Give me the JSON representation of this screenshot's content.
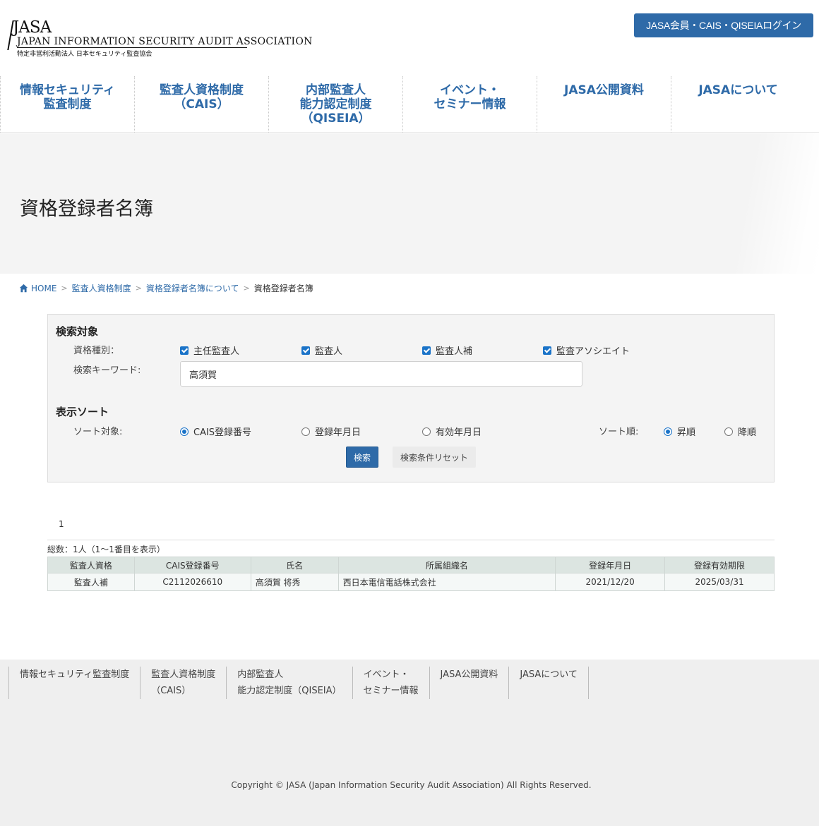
{
  "header": {
    "logo": {
      "line1": "JASA",
      "line2": "JAPAN INFORMATION SECURITY AUDIT ASSOCIATION",
      "line3": "特定非営利活動法人 日本セキュリティ監査協会"
    },
    "login_label": "JASA会員・CAIS・QISEIAログイン"
  },
  "nav": {
    "items": [
      {
        "label": "情報セキュリティ\n監査制度"
      },
      {
        "label": "監査人資格制度\n（CAIS）"
      },
      {
        "label": "内部監査人\n能力認定制度\n（QISEIA）"
      },
      {
        "label": "イベント・\nセミナー情報"
      },
      {
        "label": "JASA公開資料"
      },
      {
        "label": "JASAについて"
      }
    ]
  },
  "page": {
    "title": "資格登録者名簿"
  },
  "breadcrumb": {
    "home": "HOME",
    "items": [
      "監査人資格制度",
      "資格登録者名簿について"
    ],
    "current": "資格登録者名簿",
    "separator": ">"
  },
  "search": {
    "section_title": "検索対象",
    "type_label": "資格種別：",
    "types": [
      {
        "label": "主任監査人",
        "checked": true
      },
      {
        "label": "監査人",
        "checked": true
      },
      {
        "label": "監査人補",
        "checked": true
      },
      {
        "label": "監査アソシエイト",
        "checked": true
      }
    ],
    "keyword_label": "検索キーワード:",
    "keyword_value": "高須賀"
  },
  "sort": {
    "section_title": "表示ソート",
    "target_label": "ソート対象:",
    "targets": [
      {
        "label": "CAIS登録番号",
        "selected": true
      },
      {
        "label": "登録年月日",
        "selected": false
      },
      {
        "label": "有効年月日",
        "selected": false
      }
    ],
    "order_label": "ソート順:",
    "orders": [
      {
        "label": "昇順",
        "selected": true
      },
      {
        "label": "降順",
        "selected": false
      }
    ],
    "search_button": "検索",
    "reset_button": "検索条件リセット"
  },
  "results": {
    "page": "1",
    "total": "総数：1人（1～1番目を表示）",
    "columns": [
      "監査人資格",
      "CAIS登録番号",
      "氏名",
      "所属組織名",
      "登録年月日",
      "登録有効期限"
    ],
    "rows": [
      [
        "監査人補",
        "C2112026610",
        "高須賀 将秀",
        "西日本電信電話株式会社",
        "2021/12/20",
        "2025/03/31"
      ]
    ]
  },
  "footer": {
    "nav": [
      {
        "label": "情報セキュリティ監査制度"
      },
      {
        "label": "監査人資格制度\n（CAIS）"
      },
      {
        "label": "内部監査人\n能力認定制度（QISEIA）"
      },
      {
        "label": "イベント・\nセミナー情報"
      },
      {
        "label": "JASA公開資料"
      },
      {
        "label": "JASAについて"
      }
    ],
    "copyright": "Copyright © JASA (Japan Information Security Audit Association) All Rights Reserved."
  },
  "colors": {
    "brand": "#2e6aa8",
    "checkbox": "#1a73c8",
    "table_header": "#dce5e1",
    "footer_bg": "#efefef"
  }
}
